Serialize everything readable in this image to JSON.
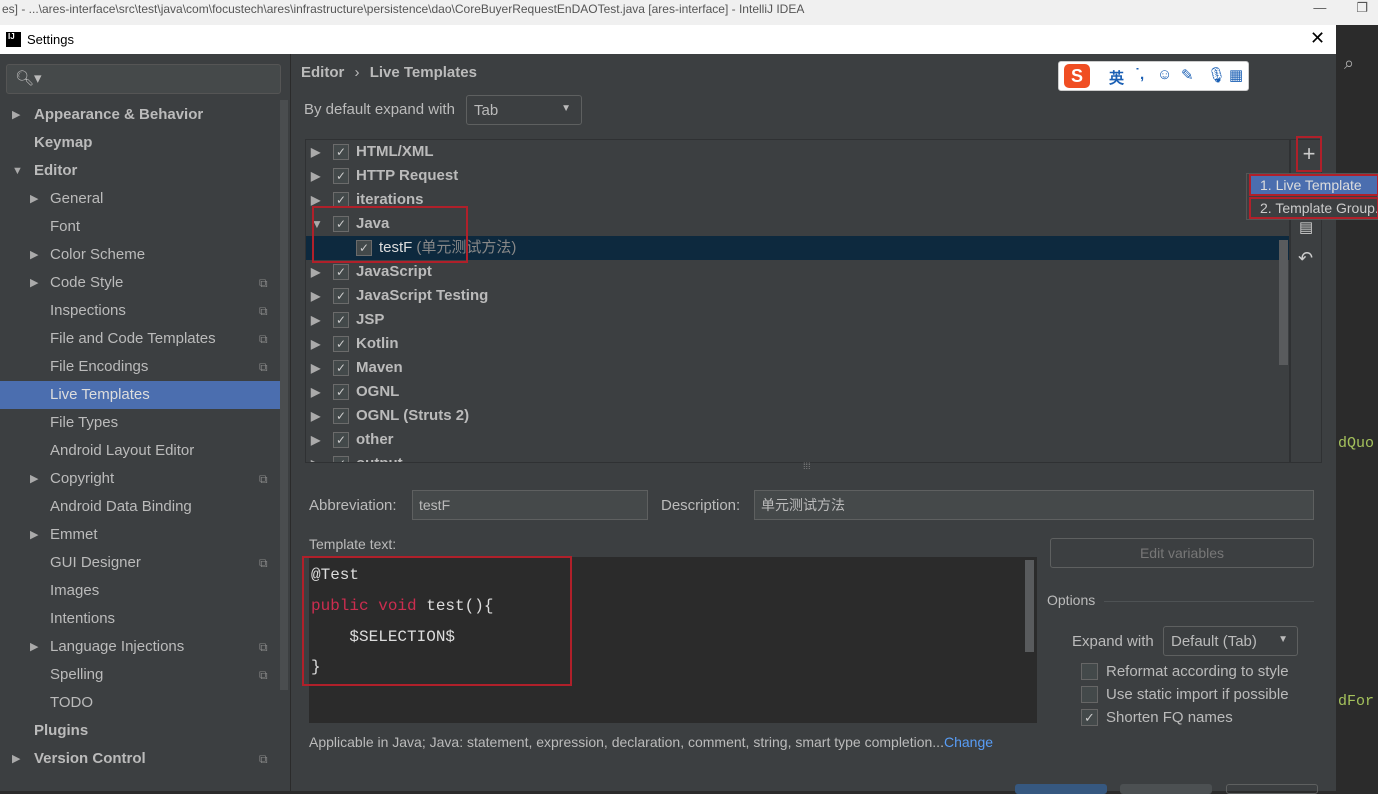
{
  "ide": {
    "title": "es] - ...\\ares-interface\\src\\test\\java\\com\\focustech\\ares\\infrastructure\\persistence\\dao\\CoreBuyerRequestEnDAOTest.java [ares-interface] - IntelliJ IDEA"
  },
  "dialog": {
    "title": "Settings",
    "logo": "IJ"
  },
  "sidebar": {
    "search_placeholder": "",
    "items": [
      {
        "label": "Appearance & Behavior",
        "level": 0,
        "arrow": "▶",
        "bold": true
      },
      {
        "label": "Keymap",
        "level": 0,
        "arrow": "",
        "bold": true
      },
      {
        "label": "Editor",
        "level": 0,
        "arrow": "▼",
        "bold": true
      },
      {
        "label": "General",
        "level": 1,
        "arrow": "▶"
      },
      {
        "label": "Font",
        "level": 1,
        "arrow": ""
      },
      {
        "label": "Color Scheme",
        "level": 1,
        "arrow": "▶"
      },
      {
        "label": "Code Style",
        "level": 1,
        "arrow": "▶",
        "copy": true
      },
      {
        "label": "Inspections",
        "level": 1,
        "arrow": "",
        "copy": true
      },
      {
        "label": "File and Code Templates",
        "level": 1,
        "arrow": "",
        "copy": true
      },
      {
        "label": "File Encodings",
        "level": 1,
        "arrow": "",
        "copy": true
      },
      {
        "label": "Live Templates",
        "level": 1,
        "arrow": "",
        "selected": true
      },
      {
        "label": "File Types",
        "level": 1,
        "arrow": ""
      },
      {
        "label": "Android Layout Editor",
        "level": 1,
        "arrow": ""
      },
      {
        "label": "Copyright",
        "level": 1,
        "arrow": "▶",
        "copy": true
      },
      {
        "label": "Android Data Binding",
        "level": 1,
        "arrow": ""
      },
      {
        "label": "Emmet",
        "level": 1,
        "arrow": "▶"
      },
      {
        "label": "GUI Designer",
        "level": 1,
        "arrow": "",
        "copy": true
      },
      {
        "label": "Images",
        "level": 1,
        "arrow": ""
      },
      {
        "label": "Intentions",
        "level": 1,
        "arrow": ""
      },
      {
        "label": "Language Injections",
        "level": 1,
        "arrow": "▶",
        "copy": true
      },
      {
        "label": "Spelling",
        "level": 1,
        "arrow": "",
        "copy": true
      },
      {
        "label": "TODO",
        "level": 1,
        "arrow": ""
      },
      {
        "label": "Plugins",
        "level": 0,
        "arrow": "",
        "bold": true
      },
      {
        "label": "Version Control",
        "level": 0,
        "arrow": "▶",
        "bold": true,
        "copy": true
      }
    ]
  },
  "breadcrumb": {
    "parent": "Editor",
    "sep": "›",
    "current": "Live Templates"
  },
  "expand_default": {
    "label": "By default expand with",
    "value": "Tab"
  },
  "ime_toolbar": {
    "logo": "S",
    "lang": "英",
    "punct": "˙,"
  },
  "templates": [
    {
      "label": "HTML/XML",
      "expanded": false,
      "checked": true
    },
    {
      "label": "HTTP Request",
      "expanded": false,
      "checked": true
    },
    {
      "label": "iterations",
      "expanded": false,
      "checked": true
    },
    {
      "label": "Java",
      "expanded": true,
      "checked": true
    },
    {
      "label": "testF",
      "desc": "(单元测试方法)",
      "child": true,
      "checked": true,
      "selected": true
    },
    {
      "label": "JavaScript",
      "expanded": false,
      "checked": true
    },
    {
      "label": "JavaScript Testing",
      "expanded": false,
      "checked": true
    },
    {
      "label": "JSP",
      "expanded": false,
      "checked": true
    },
    {
      "label": "Kotlin",
      "expanded": false,
      "checked": true
    },
    {
      "label": "Maven",
      "expanded": false,
      "checked": true
    },
    {
      "label": "OGNL",
      "expanded": false,
      "checked": true
    },
    {
      "label": "OGNL (Struts 2)",
      "expanded": false,
      "checked": true
    },
    {
      "label": "other",
      "expanded": false,
      "checked": true
    },
    {
      "label": "output",
      "expanded": false,
      "checked": true
    }
  ],
  "add_menu": {
    "items": [
      "1. Live Template",
      "2. Template Group..."
    ]
  },
  "editor": {
    "abbreviation_label": "Abbreviation:",
    "abbreviation": "testF",
    "description_label": "Description:",
    "description": "单元测试方法",
    "template_text_label": "Template text:",
    "code": {
      "l1": "@Test",
      "kw": "public void",
      "l2": " test(){",
      "l3": "    $SELECTION$",
      "l4": "}"
    },
    "edit_variables": "Edit variables",
    "applicable": "Applicable in Java; Java: statement, expression, declaration, comment, string, smart type completion...",
    "change": "Change"
  },
  "options": {
    "title": "Options",
    "expand_with_label": "Expand with",
    "expand_with": "Default (Tab)",
    "reformat": {
      "label": "Reformat according to style",
      "checked": false
    },
    "static_import": {
      "label": "Use static import if possible",
      "checked": false
    },
    "shorten_fq": {
      "label": "Shorten FQ names",
      "checked": true
    }
  },
  "colors": {
    "accent": "#4b6eaf",
    "selection": "#0d293e",
    "highlight_box": "#b0202a",
    "keyword": "#cc2d4f",
    "link": "#589df6"
  }
}
